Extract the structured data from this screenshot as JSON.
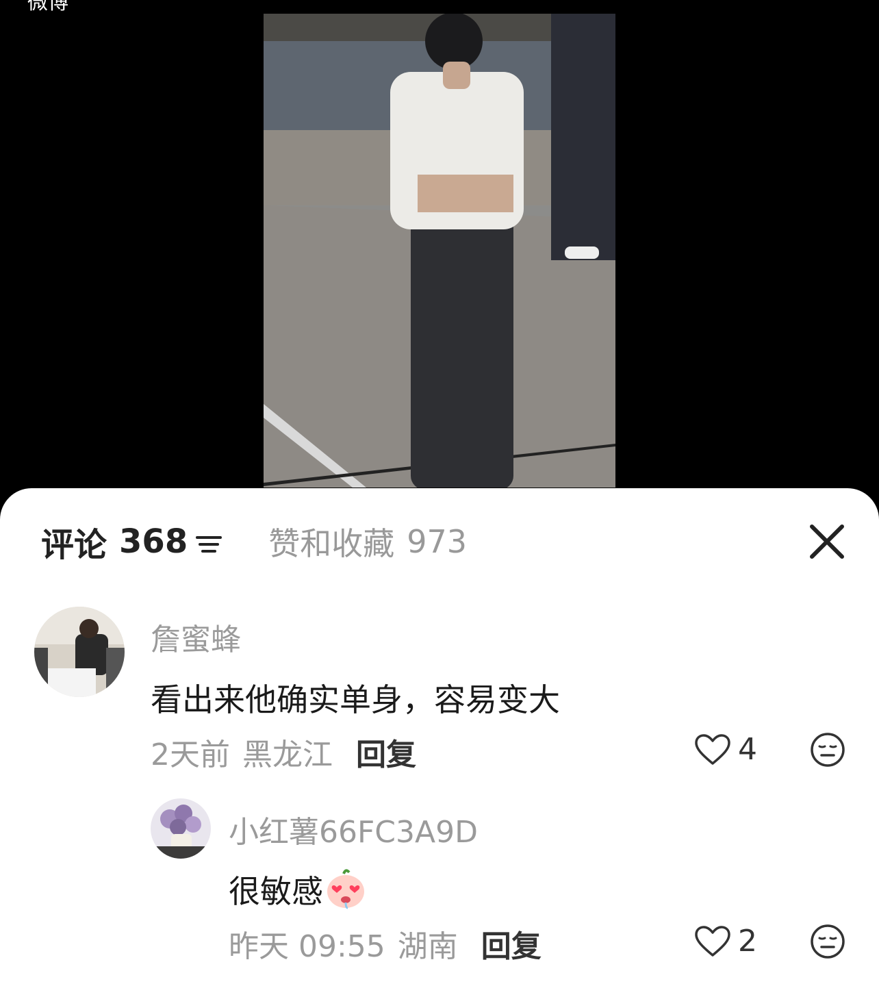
{
  "top": {
    "back_label": "微博"
  },
  "tabs": {
    "comments_label": "评论",
    "comments_count": "368",
    "likes_label": "赞和收藏",
    "likes_count": "973"
  },
  "comments": [
    {
      "user": "詹蜜蜂",
      "text": "看出来他确实单身，容易变大",
      "time": "2天前",
      "location": "黑龙江",
      "reply_label": "回复",
      "likes": "4"
    },
    {
      "user": "小红薯66FC3A9D",
      "text": "很敏感",
      "emoji": "heart-eyes-face",
      "time": "昨天 09:55",
      "location": "湖南",
      "reply_label": "回复",
      "likes": "2"
    }
  ],
  "icons": {
    "sort": "sort-icon",
    "close": "close-icon",
    "heart": "heart-outline-icon",
    "react": "neutral-face-icon"
  },
  "colors": {
    "muted_text": "#9a9a9a",
    "primary_text": "#1a1a1a",
    "sheet_bg": "#ffffff",
    "backdrop": "#000000"
  }
}
